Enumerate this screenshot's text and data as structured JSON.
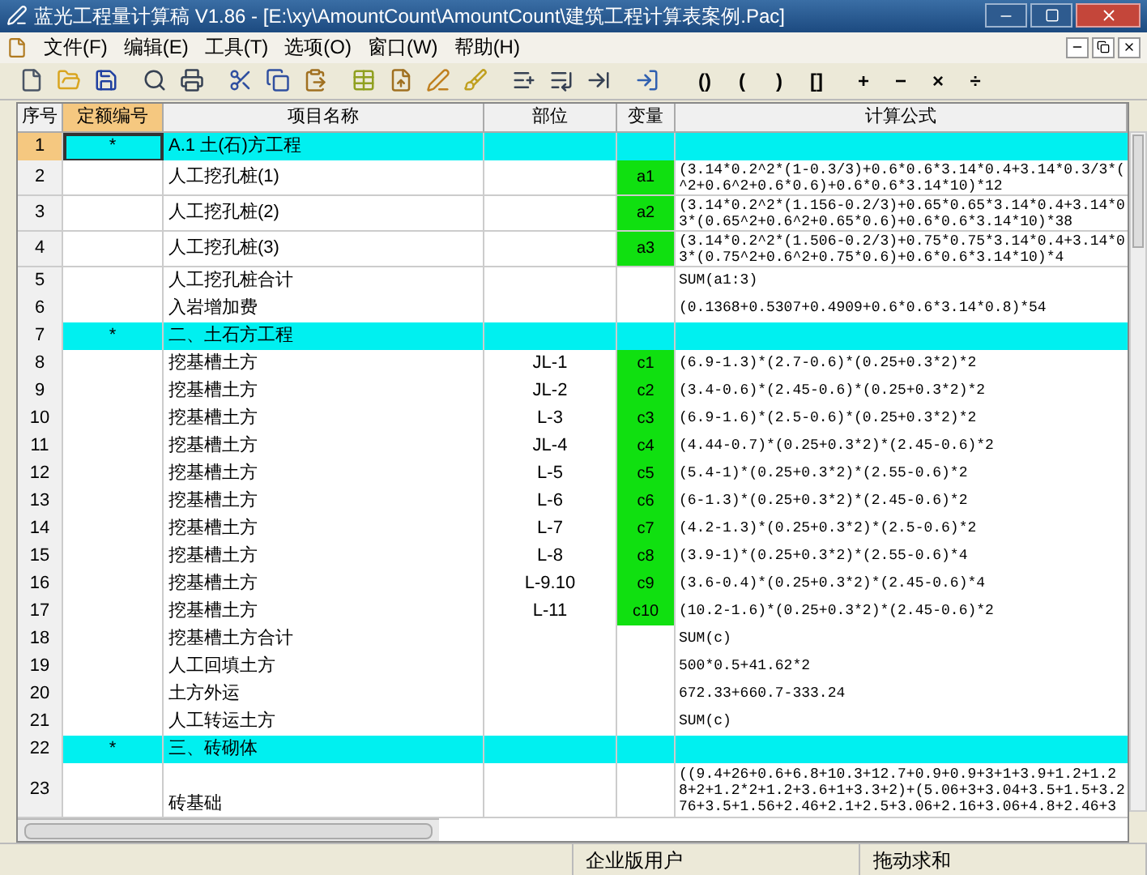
{
  "window": {
    "title": "蓝光工程量计算稿 V1.86 - [E:\\xy\\AmountCount\\AmountCount\\建筑工程计算表案例.Pac]"
  },
  "menu": [
    "文件(F)",
    "编辑(E)",
    "工具(T)",
    "选项(O)",
    "窗口(W)",
    "帮助(H)"
  ],
  "operators": [
    "()",
    "(",
    ")",
    "[]",
    "+",
    "−",
    "×",
    "÷"
  ],
  "table": {
    "columns": [
      {
        "label": "序号",
        "selected": false
      },
      {
        "label": "定额编号",
        "selected": true
      },
      {
        "label": "项目名称",
        "selected": false
      },
      {
        "label": "部位",
        "selected": false
      },
      {
        "label": "变量",
        "selected": false
      },
      {
        "label": "计算公式",
        "selected": false
      }
    ],
    "rows": [
      {
        "kind": "group",
        "number": "1",
        "selected": true,
        "code": "*",
        "name": "A.1 土(石)方工程"
      },
      {
        "kind": "item",
        "number": "2",
        "selected": false,
        "name": "人工挖孔桩(1)",
        "variable": "a1",
        "formula_lines": [
          "(3.14*0.2^2*(1-0.3/3)+0.6*0.6*3.14*0.4+3.14*0.3/3*(",
          "^2+0.6^2+0.6*0.6)+0.6*0.6*3.14*10)*12"
        ]
      },
      {
        "kind": "item",
        "number": "3",
        "selected": false,
        "name": "人工挖孔桩(2)",
        "variable": "a2",
        "formula_lines": [
          "(3.14*0.2^2*(1.156-0.2/3)+0.65*0.65*3.14*0.4+3.14*0",
          "3*(0.65^2+0.6^2+0.65*0.6)+0.6*0.6*3.14*10)*38"
        ]
      },
      {
        "kind": "item",
        "number": "4",
        "selected": false,
        "name": "人工挖孔桩(3)",
        "variable": "a3",
        "formula_lines": [
          "(3.14*0.2^2*(1.506-0.2/3)+0.75*0.75*3.14*0.4+3.14*0",
          "3*(0.75^2+0.6^2+0.75*0.6)+0.6*0.6*3.14*10)*4"
        ]
      },
      {
        "kind": "item",
        "number": "5",
        "selected": false,
        "name": "人工挖孔桩合计",
        "formula_lines": [
          "SUM(a1:3)"
        ]
      },
      {
        "kind": "item",
        "number": "6",
        "selected": false,
        "name": "入岩增加费",
        "formula_lines": [
          "(0.1368+0.5307+0.4909+0.6*0.6*3.14*0.8)*54"
        ]
      },
      {
        "kind": "group",
        "number": "7",
        "selected": false,
        "code": "*",
        "name": "二、土石方工程"
      },
      {
        "kind": "item",
        "number": "8",
        "selected": false,
        "name": "挖基槽土方",
        "part": "JL-1",
        "variable": "c1",
        "formula_lines": [
          "(6.9-1.3)*(2.7-0.6)*(0.25+0.3*2)*2"
        ]
      },
      {
        "kind": "item",
        "number": "9",
        "selected": false,
        "name": "挖基槽土方",
        "part": "JL-2",
        "variable": "c2",
        "formula_lines": [
          "(3.4-0.6)*(2.45-0.6)*(0.25+0.3*2)*2"
        ]
      },
      {
        "kind": "item",
        "number": "10",
        "selected": false,
        "name": "挖基槽土方",
        "part": "L-3",
        "variable": "c3",
        "formula_lines": [
          "(6.9-1.6)*(2.5-0.6)*(0.25+0.3*2)*2"
        ]
      },
      {
        "kind": "item",
        "number": "11",
        "selected": false,
        "name": "挖基槽土方",
        "part": "JL-4",
        "variable": "c4",
        "formula_lines": [
          "(4.44-0.7)*(0.25+0.3*2)*(2.45-0.6)*2"
        ]
      },
      {
        "kind": "item",
        "number": "12",
        "selected": false,
        "name": "挖基槽土方",
        "part": "L-5",
        "variable": "c5",
        "formula_lines": [
          "(5.4-1)*(0.25+0.3*2)*(2.55-0.6)*2"
        ]
      },
      {
        "kind": "item",
        "number": "13",
        "selected": false,
        "name": "挖基槽土方",
        "part": "L-6",
        "variable": "c6",
        "formula_lines": [
          "(6-1.3)*(0.25+0.3*2)*(2.45-0.6)*2"
        ]
      },
      {
        "kind": "item",
        "number": "14",
        "selected": false,
        "name": "挖基槽土方",
        "part": "L-7",
        "variable": "c7",
        "formula_lines": [
          "(4.2-1.3)*(0.25+0.3*2)*(2.5-0.6)*2"
        ]
      },
      {
        "kind": "item",
        "number": "15",
        "selected": false,
        "name": "挖基槽土方",
        "part": "L-8",
        "variable": "c8",
        "formula_lines": [
          "(3.9-1)*(0.25+0.3*2)*(2.55-0.6)*4"
        ]
      },
      {
        "kind": "item",
        "number": "16",
        "selected": false,
        "name": "挖基槽土方",
        "part": "L-9.10",
        "variable": "c9",
        "formula_lines": [
          "(3.6-0.4)*(0.25+0.3*2)*(2.45-0.6)*4"
        ]
      },
      {
        "kind": "item",
        "number": "17",
        "selected": false,
        "name": "挖基槽土方",
        "part": "L-11",
        "variable": "c10",
        "formula_lines": [
          "(10.2-1.6)*(0.25+0.3*2)*(2.45-0.6)*2"
        ]
      },
      {
        "kind": "item",
        "number": "18",
        "selected": false,
        "name": "挖基槽土方合计",
        "formula_lines": [
          "SUM(c)"
        ]
      },
      {
        "kind": "item",
        "number": "19",
        "selected": false,
        "name": "人工回填土方",
        "formula_lines": [
          "500*0.5+41.62*2"
        ]
      },
      {
        "kind": "item",
        "number": "20",
        "selected": false,
        "name": "土方外运",
        "formula_lines": [
          "672.33+660.7-333.24"
        ]
      },
      {
        "kind": "item",
        "number": "21",
        "selected": false,
        "name": "人工转运土方",
        "formula_lines": [
          "SUM(c)"
        ]
      },
      {
        "kind": "group",
        "number": "22",
        "selected": false,
        "code": "*",
        "name": "三、砖砌体"
      },
      {
        "kind": "item",
        "number": "23",
        "selected": false,
        "name": "砖基础",
        "formula_lines": [
          "((9.4+26+0.6+6.8+10.3+12.7+0.9+0.9+3+1+3.9+1.2+1.2",
          "8+2+1.2*2+1.2+3.6+1+3.3+2)+(5.06+3+3.04+3.5+1.5+3.2",
          "76+3.5+1.56+2.46+2.1+2.5+3.06+2.16+3.06+4.8+2.46+3"
        ]
      }
    ]
  },
  "status_bar": [
    "企业版用户",
    "拖动求和"
  ]
}
